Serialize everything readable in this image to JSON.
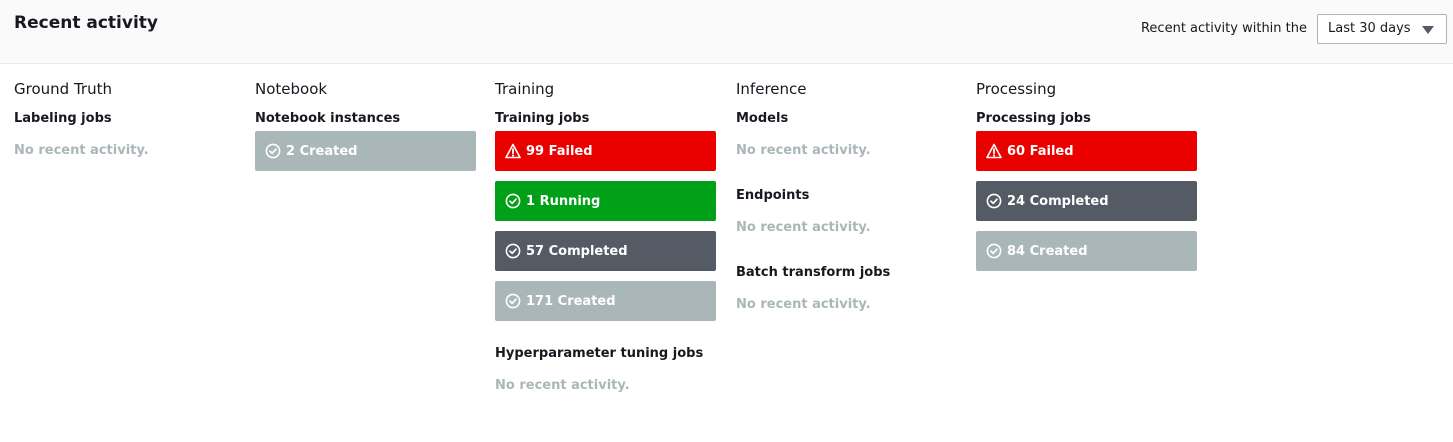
{
  "header": {
    "title": "Recent activity",
    "range_label": "Recent activity within the",
    "range_value": "Last 30 days"
  },
  "columns": {
    "ground_truth": {
      "title": "Ground Truth",
      "labeling": {
        "title": "Labeling jobs",
        "empty": "No recent activity."
      }
    },
    "notebook": {
      "title": "Notebook",
      "instances": {
        "title": "Notebook instances",
        "stats": [
          {
            "label": "2 Created",
            "status": "created"
          }
        ]
      }
    },
    "training": {
      "title": "Training",
      "jobs": {
        "title": "Training jobs",
        "stats": [
          {
            "label": "99 Failed",
            "status": "failed"
          },
          {
            "label": "1 Running",
            "status": "running"
          },
          {
            "label": "57 Completed",
            "status": "completed"
          },
          {
            "label": "171 Created",
            "status": "created"
          }
        ]
      },
      "tuning": {
        "title": "Hyperparameter tuning jobs",
        "empty": "No recent activity."
      }
    },
    "inference": {
      "title": "Inference",
      "models": {
        "title": "Models",
        "empty": "No recent activity."
      },
      "endpoints": {
        "title": "Endpoints",
        "empty": "No recent activity."
      },
      "batch": {
        "title": "Batch transform jobs",
        "empty": "No recent activity."
      }
    },
    "processing": {
      "title": "Processing",
      "jobs": {
        "title": "Processing jobs",
        "stats": [
          {
            "label": "60 Failed",
            "status": "failed"
          },
          {
            "label": "24 Completed",
            "status": "completed"
          },
          {
            "label": "84 Created",
            "status": "created"
          }
        ]
      }
    }
  },
  "icons": {
    "failed": "warning-icon",
    "ok": "check-circle-icon"
  },
  "colors": {
    "failed": "#eb0000",
    "running": "#00a118",
    "completed": "#545b64",
    "created": "#aab7b8",
    "muted": "#aab7b8"
  }
}
